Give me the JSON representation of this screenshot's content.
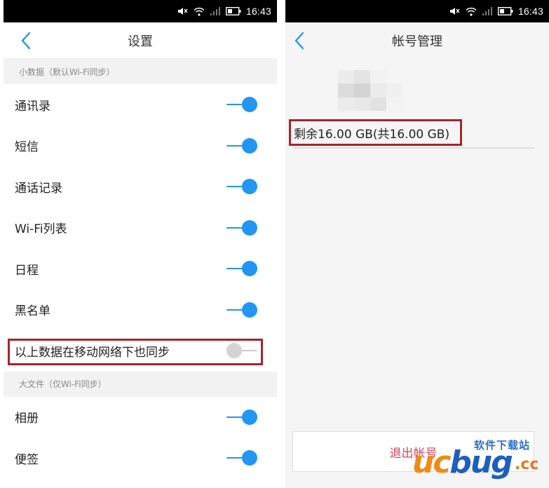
{
  "left_screen": {
    "status_bar": {
      "time": "16:43",
      "icons": [
        "mute-icon",
        "wifi-icon",
        "signal-icon",
        "battery-icon"
      ]
    },
    "header": {
      "back_icon": "chevron-left-icon",
      "title": "设置"
    },
    "section_small": {
      "title": "小数据（默认Wi-Fi同步）",
      "items": [
        {
          "label": "通讯录",
          "enabled": true
        },
        {
          "label": "短信",
          "enabled": true
        },
        {
          "label": "通话记录",
          "enabled": true
        },
        {
          "label": "Wi-Fi列表",
          "enabled": true
        },
        {
          "label": "日程",
          "enabled": true
        },
        {
          "label": "黑名单",
          "enabled": true
        },
        {
          "label": "以上数据在移动网络下也同步",
          "enabled": false
        }
      ]
    },
    "section_large": {
      "title": "大文件（仅Wi-Fi同步）",
      "items": [
        {
          "label": "相册",
          "enabled": true
        },
        {
          "label": "便签",
          "enabled": true
        }
      ]
    }
  },
  "right_screen": {
    "status_bar": {
      "time": "16:43",
      "icons": [
        "mute-icon",
        "wifi-icon",
        "signal-icon",
        "battery-icon"
      ]
    },
    "header": {
      "back_icon": "chevron-left-icon",
      "title": "帐号管理"
    },
    "storage": {
      "text": "剩余16.00 GB(共16.00 GB)"
    },
    "logout": {
      "label": "退出帐号"
    }
  },
  "watermark": {
    "top": "软件下载站",
    "logo_c": "uc",
    "logo_rest": "bug",
    "suffix": ".cc"
  },
  "colors": {
    "accent": "#2196f3",
    "highlight": "#a8242c",
    "logout": "#e0405a"
  }
}
